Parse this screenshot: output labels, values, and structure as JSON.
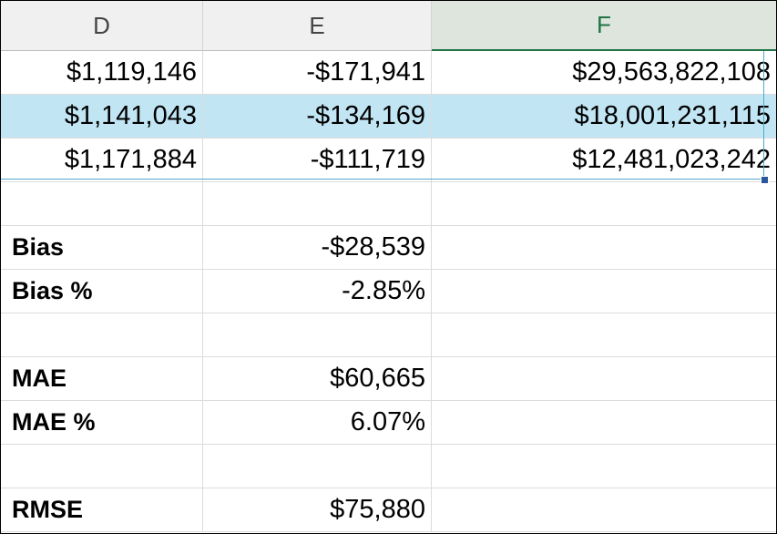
{
  "columns": [
    "D",
    "E",
    "F"
  ],
  "rows": [
    {
      "d": "$1,119,146",
      "e": "-$171,941",
      "f": "$29,563,822,108"
    },
    {
      "d": "$1,141,043",
      "e": "-$134,169",
      "f": "$18,001,231,115"
    },
    {
      "d": "$1,171,884",
      "e": "-$111,719",
      "f": "$12,481,023,242"
    },
    {
      "d": "",
      "e": "",
      "f": ""
    },
    {
      "d": "Bias",
      "e": "-$28,539",
      "f": ""
    },
    {
      "d": "Bias %",
      "e": "-2.85%",
      "f": ""
    },
    {
      "d": "",
      "e": "",
      "f": ""
    },
    {
      "d": "MAE",
      "e": "$60,665",
      "f": ""
    },
    {
      "d": "MAE %",
      "e": "6.07%",
      "f": ""
    },
    {
      "d": "",
      "e": "",
      "f": ""
    },
    {
      "d": "RMSE",
      "e": "$75,880",
      "f": ""
    }
  ],
  "colors": {
    "highlight_row": "#c2e5f3",
    "selected_header": "#217346",
    "header_bg": "#f0f0f0",
    "gridline": "#dcdcdc"
  }
}
